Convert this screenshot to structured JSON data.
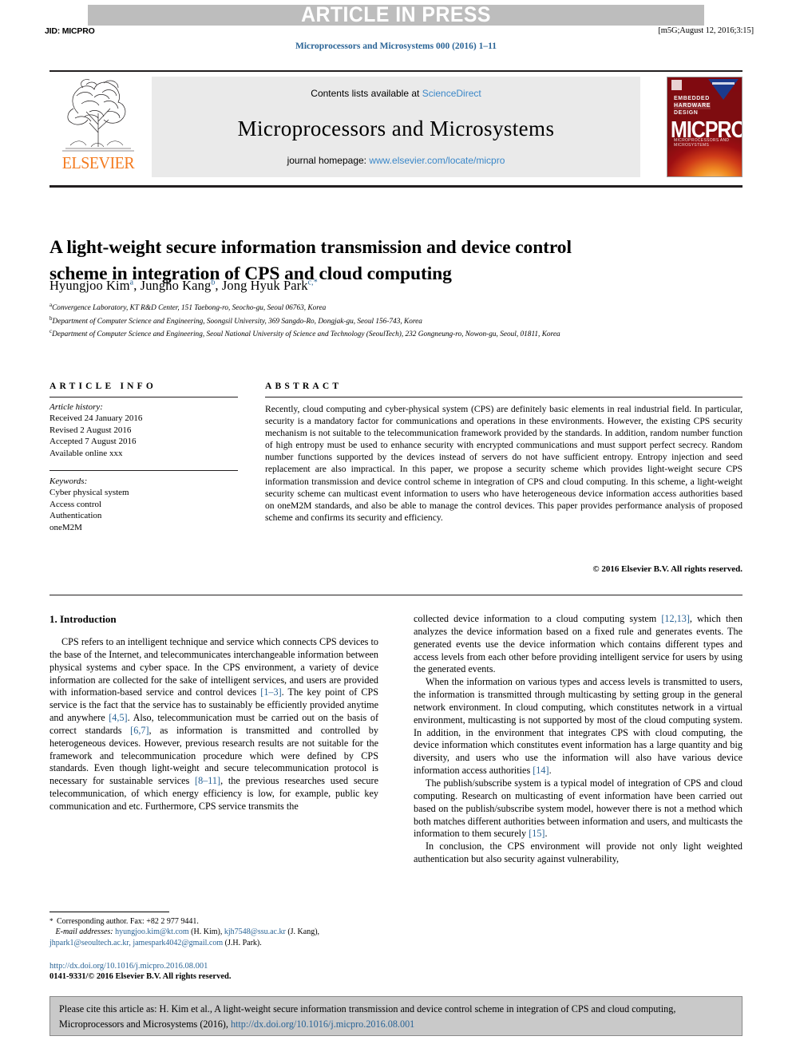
{
  "header": {
    "press_banner": "ARTICLE IN PRESS",
    "jid": "JID: MICPRO",
    "production_mark": "[m5G;August 12, 2016;3:15]",
    "journal_reference": "Microprocessors and Microsystems 000 (2016) 1–11"
  },
  "masthead": {
    "contents_prefix": "Contents lists available at ",
    "contents_link": "ScienceDirect",
    "journal_title": "Microprocessors and Microsystems",
    "homepage_prefix": "journal homepage: ",
    "homepage_link": "www.elsevier.com/locate/micpro",
    "publisher": "ELSEVIER",
    "cover": {
      "sub_line1": "EMBEDDED",
      "sub_line2": "HARDWARE",
      "sub_line3": "DESIGN",
      "main": "MICPRO",
      "tagline": "MICROPROCESSORS AND MICROSYSTEMS"
    }
  },
  "article": {
    "title": "A light-weight secure information transmission and device control scheme in integration of CPS and cloud computing",
    "authors": [
      {
        "name": "Hyungjoo Kim",
        "marker": "a"
      },
      {
        "name": "Jungho Kang",
        "marker": "b"
      },
      {
        "name": "Jong Hyuk Park",
        "marker": "c"
      }
    ],
    "affiliations": [
      {
        "marker": "a",
        "text": "Convergence Laboratory, KT R&D Center, 151 Taebong-ro, Seocho-gu, Seoul 06763, Korea"
      },
      {
        "marker": "b",
        "text": "Department of Computer Science and Engineering, Soongsil University, 369 Sangdo-Ro, Dongjak-gu, Seoul 156-743, Korea"
      },
      {
        "marker": "c",
        "text": "Department of Computer Science and Engineering, Seoul National University of Science and Technology (SeoulTech), 232 Gongneung-ro, Nowon-gu, Seoul, 01811, Korea"
      }
    ]
  },
  "article_info": {
    "heading": "ARTICLE INFO",
    "history_label": "Article history:",
    "history": [
      "Received 24 January 2016",
      "Revised 2 August 2016",
      "Accepted 7 August 2016",
      "Available online xxx"
    ],
    "keywords_label": "Keywords:",
    "keywords": [
      "Cyber physical system",
      "Access control",
      "Authentication",
      "oneM2M"
    ]
  },
  "abstract": {
    "heading": "ABSTRACT",
    "text": "Recently, cloud computing and cyber-physical system (CPS) are definitely basic elements in real industrial field. In particular, security is a mandatory factor for communications and operations in these environments. However, the existing CPS security mechanism is not suitable to the telecommunication framework provided by the standards. In addition, random number function of high entropy must be used to enhance security with encrypted communications and must support perfect secrecy. Random number functions supported by the devices instead of servers do not have sufficient entropy. Entropy injection and seed replacement are also impractical. In this paper, we propose a security scheme which provides light-weight secure CPS information transmission and device control scheme in integration of CPS and cloud computing. In this scheme, a light-weight security scheme can multicast event information to users who have heterogeneous device information access authorities based on oneM2M standards, and also be able to manage the control devices. This paper provides performance analysis of proposed scheme and confirms its security and efficiency.",
    "copyright": "© 2016 Elsevier B.V. All rights reserved."
  },
  "body": {
    "section_title": "1. Introduction",
    "left_paragraphs": [
      {
        "segments": [
          {
            "t": "CPS refers to an intelligent technique and service which connects CPS devices to the base of the Internet, and telecommunicates interchangeable information between physical systems and cyber space. In the CPS environment, a variety of device information are collected for the sake of intelligent services, and users are provided with information-based service and control devices "
          },
          {
            "t": "[1–3]",
            "ref": true
          },
          {
            "t": ". The key point of CPS service is the fact that the service has to sustainably be efficiently provided anytime and anywhere "
          },
          {
            "t": "[4,5]",
            "ref": true
          },
          {
            "t": ". Also, telecommunication must be carried out on the basis of correct standards "
          },
          {
            "t": "[6,7]",
            "ref": true
          },
          {
            "t": ", as information is transmitted and controlled by heterogeneous devices. However, previous research results are not suitable for the framework and telecommunication procedure which were defined by CPS standards. Even though light-weight and secure telecommunication protocol is necessary for sustainable services "
          },
          {
            "t": "[8–11]",
            "ref": true
          },
          {
            "t": ", the previous researches used secure telecommunication, of which energy efficiency is low, for example, public key communication and etc. Furthermore, CPS service transmits the"
          }
        ]
      }
    ],
    "right_paragraphs": [
      {
        "continued": true,
        "segments": [
          {
            "t": "collected device information to a cloud computing system "
          },
          {
            "t": "[12,13]",
            "ref": true
          },
          {
            "t": ", which then analyzes the device information based on a fixed rule and generates events. The generated events use the device information which contains different types and access levels from each other before providing intelligent service for users by using the generated events."
          }
        ]
      },
      {
        "segments": [
          {
            "t": "When the information on various types and access levels is transmitted to users, the information is transmitted through multicasting by setting group in the general network environment. In cloud computing, which constitutes network in a virtual environment, multicasting is not supported by most of the cloud computing system. In addition, in the environment that integrates CPS with cloud computing, the device information which constitutes event information has a large quantity and big diversity, and users who use the information will also have various device information access authorities "
          },
          {
            "t": "[14]",
            "ref": true
          },
          {
            "t": "."
          }
        ]
      },
      {
        "segments": [
          {
            "t": "The publish/subscribe system is a typical model of integration of CPS and cloud computing. Research on multicasting of event information have been carried out based on the publish/subscribe system model, however there is not a method which both matches different authorities between information and users, and multicasts the information to them securely "
          },
          {
            "t": "[15]",
            "ref": true
          },
          {
            "t": "."
          }
        ]
      },
      {
        "segments": [
          {
            "t": "In conclusion, the CPS environment will provide not only light weighted authentication but also security against vulnerability,"
          }
        ]
      }
    ]
  },
  "footnote": {
    "corresponding": "Corresponding author. Fax: +82 2 977 9441.",
    "email_label": "E-mail addresses:",
    "emails": [
      {
        "address": "hyungjoo.kim@kt.com",
        "owner": "(H. Kim),"
      },
      {
        "address": "kjh7548@ssu.ac.kr",
        "owner": "(J. Kang),"
      },
      {
        "address": "jhpark1@seoultech.ac.kr,",
        "owner": ""
      },
      {
        "address": "jamespark4042@gmail.com",
        "owner": "(J.H. Park)."
      }
    ],
    "doi": "http://dx.doi.org/10.1016/j.micpro.2016.08.001",
    "issn_line": "0141-9331/© 2016 Elsevier B.V. All rights reserved."
  },
  "cite_box": {
    "text_before": "Please cite this article as: H. Kim et al., A light-weight secure information transmission and device control scheme in integration of CPS and cloud computing, Microprocessors and Microsystems (2016), ",
    "link": "http://dx.doi.org/10.1016/j.micpro.2016.08.001"
  }
}
